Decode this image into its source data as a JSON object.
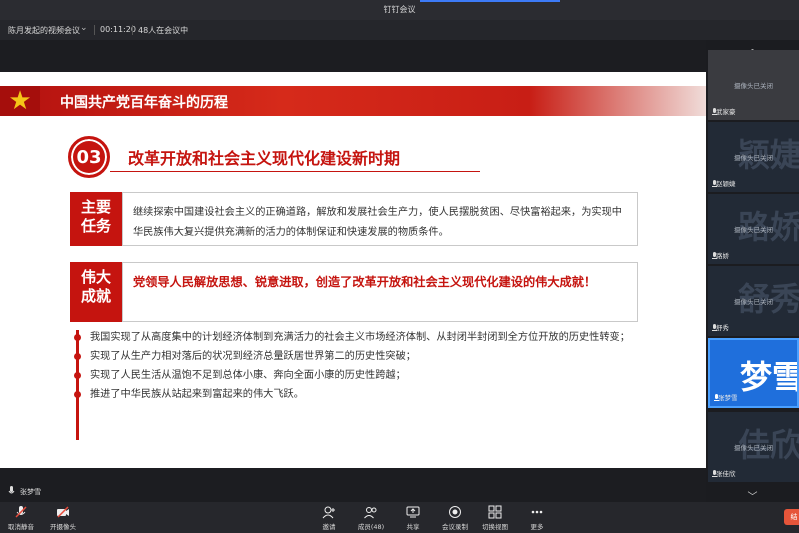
{
  "window": {
    "app_title": "钉钉会议"
  },
  "meeting": {
    "name": "陈月发起的视频会议",
    "timer": "00:11:20",
    "participants": "48人在会议中"
  },
  "slide": {
    "header": "中国共产党百年奋斗的历程",
    "section_number": "03",
    "section_title": "改革开放和社会主义现代化建设新时期",
    "task_tag": "主要任务",
    "task_text": "继续探索中国建设社会主义的正确道路，解放和发展社会生产力，使人民摆脱贫困、尽快富裕起来，为实现中华民族伟大复兴提供充满新的活力的体制保证和快速发展的物质条件。",
    "achieve_tag": "伟大成就",
    "achieve_text": "党领导人民解放思想、锐意进取，创造了改革开放和社会主义现代化建设的伟大成就！",
    "achievements": [
      "我国实现了从高度集中的计划经济体制到充满活力的社会主义市场经济体制、从封闭半封闭到全方位开放的历史性转变；",
      "实现了从生产力相对落后的状况到经济总量跃居世界第二的历史性突破；",
      "实现了人民生活从温饱不足到总体小康、奔向全面小康的历史性跨越；",
      "推进了中华民族从站起来到富起来的伟大飞跃。"
    ],
    "colors": {
      "primary_red": "#c5140f",
      "star": "#f5c518"
    }
  },
  "participants_panel": {
    "camera_off": "摄像头已关闭",
    "tiles": [
      {
        "name": "武家豪",
        "big": ""
      },
      {
        "name": "赵颖婕",
        "big": "颖婕"
      },
      {
        "name": "路娇",
        "big": "路娇"
      },
      {
        "name": "舒秀",
        "big": "舒秀"
      },
      {
        "name": "张梦雪",
        "big": "梦雪"
      },
      {
        "name": "张佳欣",
        "big": "佳欣"
      }
    ]
  },
  "speaker": {
    "name": "张梦雪"
  },
  "toolbar": {
    "mute": "取消静音",
    "camera": "开摄像头",
    "invite": "邀请",
    "members": "成员(48)",
    "share": "共享",
    "record": "会议录制",
    "view": "切换视图",
    "more": "更多",
    "end": "结"
  }
}
